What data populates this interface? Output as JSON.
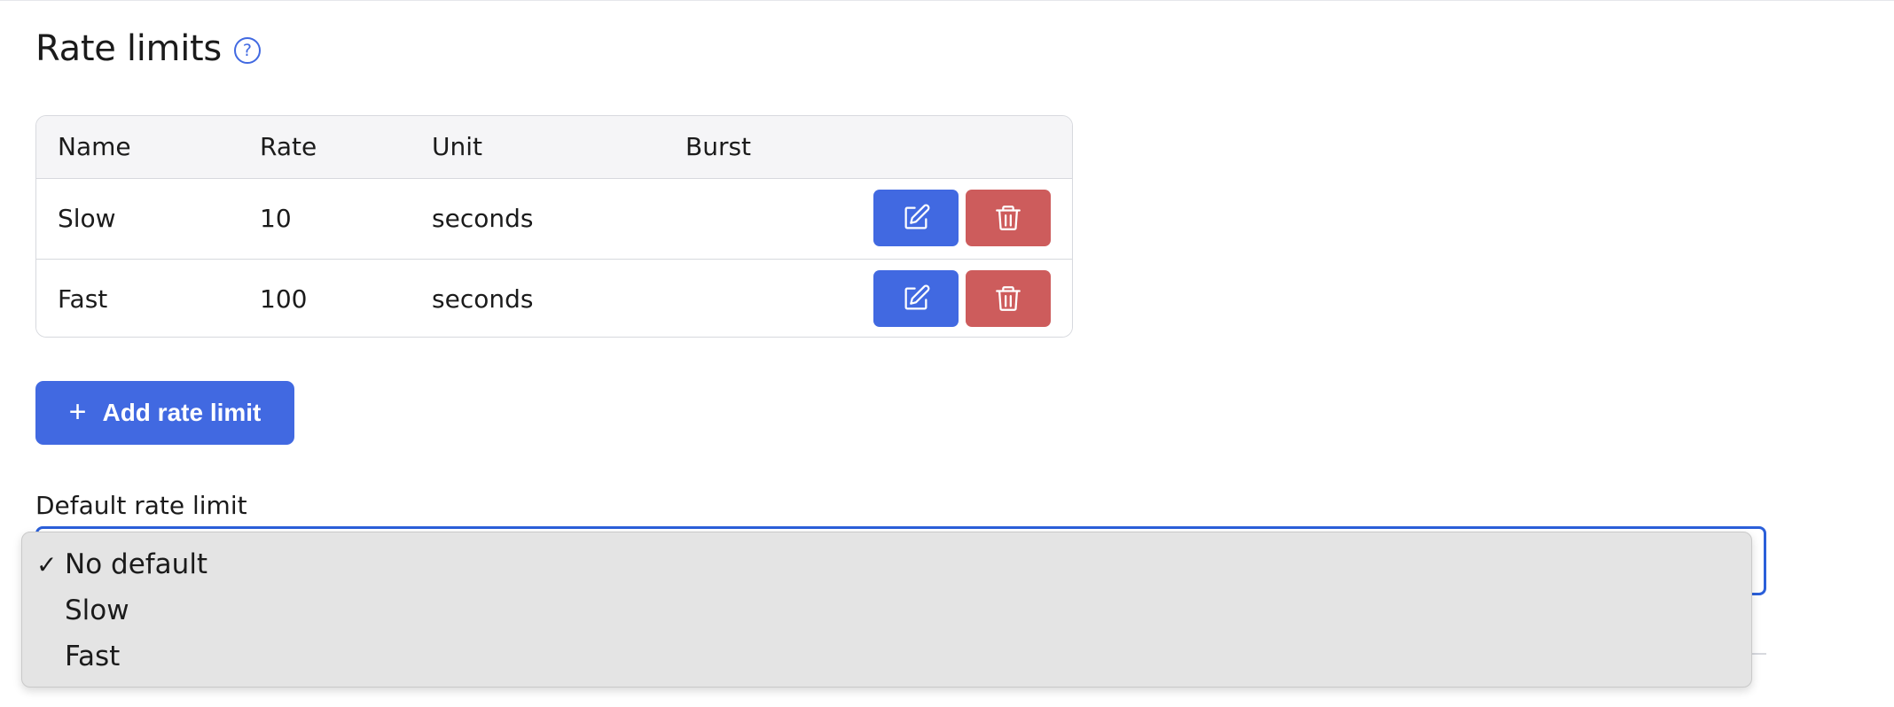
{
  "page": {
    "title": "Rate limits",
    "help_icon_glyph": "?"
  },
  "table": {
    "headers": {
      "name": "Name",
      "rate": "Rate",
      "unit": "Unit",
      "burst": "Burst"
    },
    "rows": [
      {
        "name": "Slow",
        "rate": "10",
        "unit": "seconds",
        "burst": ""
      },
      {
        "name": "Fast",
        "rate": "100",
        "unit": "seconds",
        "burst": ""
      }
    ],
    "action_icons": {
      "edit": "edit-icon",
      "delete": "trash-icon"
    }
  },
  "add_button": {
    "icon": "+",
    "label": "Add rate limit"
  },
  "default_select": {
    "label": "Default rate limit",
    "selected": "No default",
    "options": [
      {
        "label": "No default",
        "checked": true,
        "check_glyph": "✓"
      },
      {
        "label": "Slow",
        "checked": false,
        "check_glyph": ""
      },
      {
        "label": "Fast",
        "checked": false,
        "check_glyph": ""
      }
    ]
  },
  "colors": {
    "primary": "#4169e1",
    "danger": "#cd5c5c",
    "focus_border": "#2b5fd9",
    "dropdown_bg": "#e4e4e4"
  }
}
